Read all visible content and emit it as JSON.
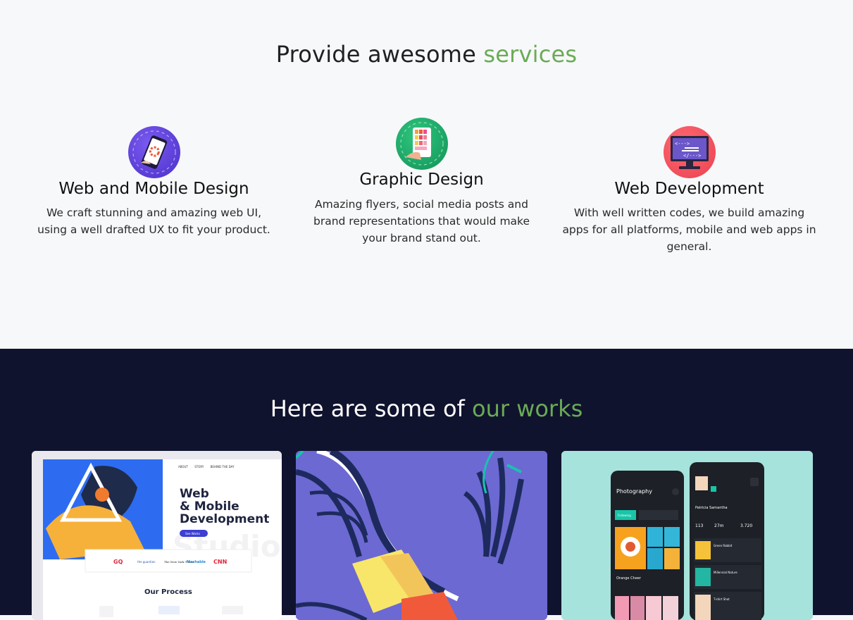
{
  "services": {
    "title_main": "Provide awesome",
    "title_accent": "services",
    "items": [
      {
        "title": "Web and Mobile Design",
        "text": "We craft stunning and amazing web UI, using a well drafted UX to fit your product.",
        "icon": "mobile-design-icon",
        "icon_color": "#5b3fd9"
      },
      {
        "title": "Graphic Design",
        "text": "Amazing flyers, social media posts and brand representations that would make your brand stand out.",
        "icon": "color-palette-icon",
        "icon_color": "#1eae6a"
      },
      {
        "title": "Web Development",
        "text": "With well written codes, we build amazing apps for all platforms, mobile and web apps in general.",
        "icon": "code-monitor-icon",
        "icon_color": "#ef4d5a"
      }
    ]
  },
  "works": {
    "title_main": "Here are some of",
    "title_accent": "our works",
    "thumb1": {
      "nav": [
        "ABOUT",
        "STORY",
        "BEHIND THE DAY"
      ],
      "headline_1": "Web",
      "headline_2": "& Mobile",
      "headline_3": "Development",
      "cta": "See Works",
      "watermark": "Studio",
      "logos": [
        "GQ",
        "the guardian",
        "The New York Times",
        "Mashable",
        "CNN"
      ],
      "process": "Our Process"
    },
    "thumb3": {
      "screen_a_title": "Photography",
      "tab_active": "Following",
      "card_caption": "Orange Cheer",
      "profile_name": "Patricia Samantha",
      "stats": [
        "113",
        "27m",
        "3.720"
      ],
      "list": [
        "Green Rabbit",
        "Millennial Nature",
        "T-shirt Shot"
      ]
    }
  },
  "colors": {
    "accent": "#6aab55",
    "dark_bg": "#10132e",
    "light_bg": "#f7f8fa"
  }
}
